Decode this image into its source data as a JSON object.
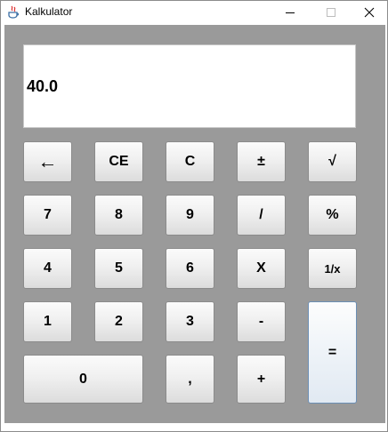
{
  "window": {
    "title": "Kalkulator",
    "controls": {
      "minimize": "—",
      "maximize": "☐",
      "close": "✕"
    }
  },
  "display": {
    "value": "40.0"
  },
  "keys": {
    "backspace": "←",
    "ce": "CE",
    "c": "C",
    "plus_minus": "±",
    "sqrt": "√",
    "seven": "7",
    "eight": "8",
    "nine": "9",
    "divide": "/",
    "percent": "%",
    "four": "4",
    "five": "5",
    "six": "6",
    "multiply": "X",
    "reciprocal": "1/x",
    "one": "1",
    "two": "2",
    "three": "3",
    "minus": "-",
    "equals": "=",
    "zero": "0",
    "comma": ",",
    "plus": "+"
  }
}
